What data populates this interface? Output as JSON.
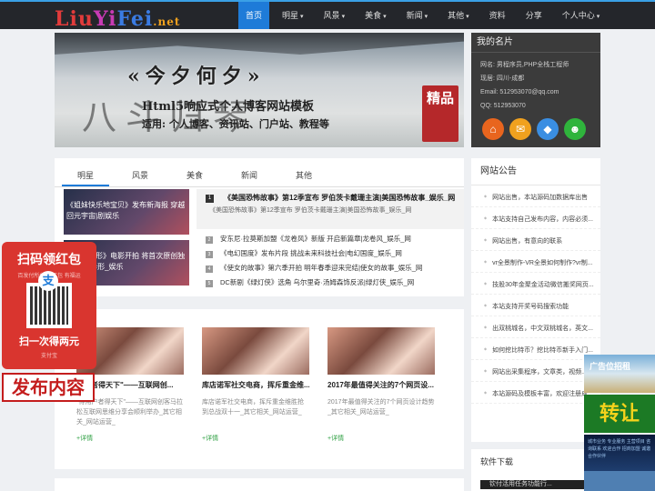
{
  "logo": {
    "part1": "Liu",
    "part2": "Yi",
    "part3": "Fei",
    "part4": ".net"
  },
  "nav": [
    {
      "label": "首页",
      "caret": ""
    },
    {
      "label": "明星",
      "caret": "▾"
    },
    {
      "label": "风景",
      "caret": "▾"
    },
    {
      "label": "美食",
      "caret": "▾"
    },
    {
      "label": "新闻",
      "caret": "▾"
    },
    {
      "label": "其他",
      "caret": "▾"
    },
    {
      "label": "资料",
      "caret": ""
    },
    {
      "label": "分享",
      "caret": ""
    },
    {
      "label": "个人中心",
      "caret": "▾"
    }
  ],
  "banner": {
    "title": "«今夕何夕»",
    "big": "八斗归琴",
    "sub1": "Html5响应式个人博客网站模板",
    "sub2": "适用: 个人博客、资讯站、门户站、教程等",
    "seal": "精品"
  },
  "profile": {
    "heading": "我的名片",
    "lines": [
      "网名: 男程序员,PHP全栈工程师",
      "现居: 四川-成都",
      "Email: 512953070@qq.com",
      "QQ: 512953070"
    ],
    "icons": {
      "home": "⌂",
      "mail": "✉",
      "qq": "◆",
      "wx": "☻"
    }
  },
  "tabs": [
    "明星",
    "风景",
    "美食",
    "新闻",
    "其他"
  ],
  "thumbs": [
    "《姐妹快乐地宝贝》发布新海报 穿越回元宇宙|剧娱乐",
    "一部《异形》电影开拍 将首次原创独立故事|异形_娱乐"
  ],
  "hot": {
    "num": "1",
    "title": "《美国恐怖故事》第12季宣布 罗伯茨卡戴珊主演|美国恐怖故事_娱乐_网",
    "desc": "《美国恐怖故事》第12季宣布 罗伯茨卡戴珊主演|美国恐怖故事_娱乐_网"
  },
  "list": [
    {
      "num": "2",
      "text": "安东尼·拉莫斯加盟《龙卷风》新版 开启新篇章|龙卷风_娱乐_网"
    },
    {
      "num": "3",
      "text": "《电幻国度》发布片段 挑战未来科技社会|电幻国度_娱乐_网"
    },
    {
      "num": "4",
      "text": "《使女的故事》第六季开拍 明年春季迎来完结|使女的故事_娱乐_网"
    },
    {
      "num": "5",
      "text": "DC新剧《绿灯侠》选角 乌尔里奇·汤姆森饰反派|绿灯侠_娱乐_网"
    }
  ],
  "grid": [
    {
      "title": "用户者得天下\"——互联网创...",
      "desc": "\"得用户者得天下\"——互联网创客马拉松互联网思维分享会顺利举办_其它相关_网站运营_",
      "more": "+详情"
    },
    {
      "title": "库店诺军社交电商，挥斥重金维...",
      "desc": "库店诺军社交电商，挥斥重金维胜抢到总战双十一_其它相关_网站运营_",
      "more": "+详情"
    },
    {
      "title": "2017年最值得关注的7个网页设...",
      "desc": "2017年最值得关注的7个网页设计趋势_其它相关_网站运营_",
      "more": "+详情"
    }
  ],
  "notice": {
    "heading": "网站公告",
    "items": [
      "网站出售，本站源码加数据库出售",
      "本站支持自己发布内容，内容必须...",
      "网站出售，有意向的联系",
      "vr全景制作-VR全景如何制作?vr制...",
      "技股30年金聚金活动微信搬奖网页...",
      "本站支持开奖号码搜索功能",
      "出双桃城名，中文双桃城名，英文...",
      "如何挖比特币？挖比特币新手入门...",
      "网站出采集程序，文章类，视频..."
    ],
    "last": "本站源码及模板丰富，欢迎注册成..."
  },
  "software": {
    "heading": "软件下载",
    "bar": "钦付活用任务功能行..."
  },
  "redpack": {
    "t1": "扫码领红包",
    "t2": "百发付所付时 红包 有福运",
    "logo": "支",
    "t3": "扫一次得两元",
    "t4": "支付宝"
  },
  "publish": "发布内容",
  "ads": {
    "ad1": "广告位招租",
    "ad2": "转让",
    "ad3": "城市业务 专业服务 主营项目 咨询联系 欢迎合作 招商加盟 诚邀合作伙伴"
  }
}
